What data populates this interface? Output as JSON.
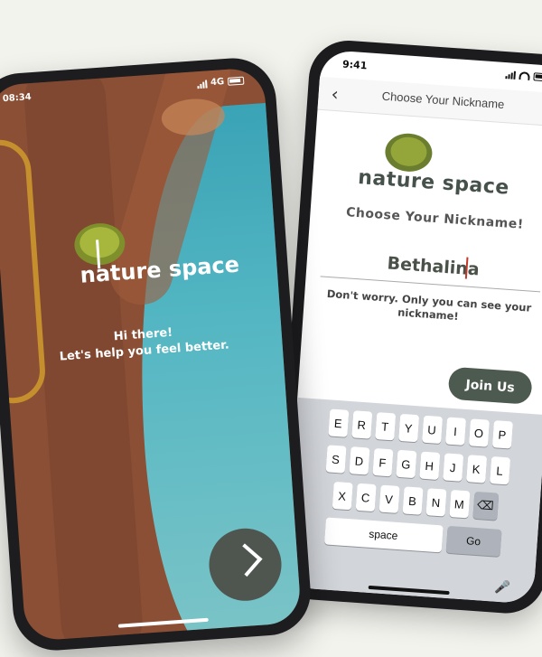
{
  "left_screen": {
    "status_time": "08:34",
    "network": "4G",
    "logo_text": "nature space",
    "greeting_line1": "Hi there!",
    "greeting_line2": "Let's help you feel better.",
    "next_icon": "chevron-right-icon"
  },
  "right_screen": {
    "status_time": "9:41",
    "nav_title": "Choose Your Nickname",
    "logo_text": "nature space",
    "heading": "Choose Your Nickname!",
    "nickname_value": "Bethalina",
    "helper_text": "Don't worry. Only you can see your nickname!",
    "join_label": "Join Us",
    "keyboard": {
      "row1": [
        "E",
        "R",
        "T",
        "Y",
        "U",
        "I",
        "O",
        "P"
      ],
      "row2": [
        "S",
        "D",
        "F",
        "G",
        "H",
        "J",
        "K",
        "L"
      ],
      "row3": [
        "X",
        "C",
        "V",
        "B",
        "N",
        "M"
      ],
      "space_label": "space",
      "go_label": "Go"
    }
  },
  "colors": {
    "trunk": "#8a4f34",
    "sky": "#3aa3b6",
    "button_dark": "#4c5a4f",
    "leaf": "#94a63a"
  }
}
